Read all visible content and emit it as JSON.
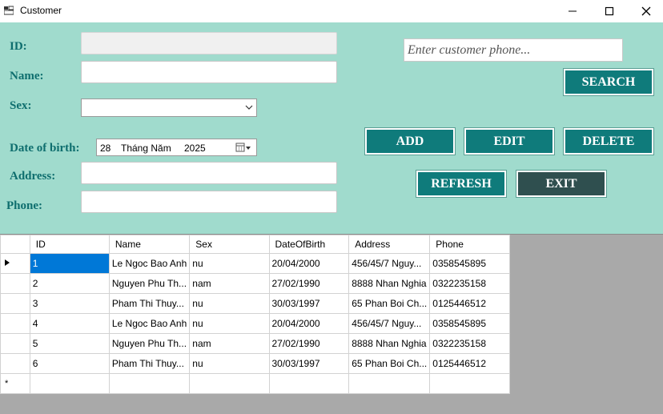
{
  "window": {
    "title": "Customer"
  },
  "form": {
    "labels": {
      "id": "ID:",
      "name": "Name:",
      "sex": "Sex:",
      "dob": "Date of birth:",
      "address": "Address:",
      "phone": "Phone:"
    },
    "values": {
      "id": "",
      "name": "",
      "sex": "",
      "address": "",
      "phone": ""
    },
    "dob": {
      "day": "28",
      "month": "Tháng Năm",
      "year": "2025"
    }
  },
  "search": {
    "placeholder": "Enter customer phone...",
    "button": "SEARCH"
  },
  "buttons": {
    "add": "ADD",
    "edit": "EDIT",
    "delete": "DELETE",
    "refresh": "REFRESH",
    "exit": "EXIT"
  },
  "colors": {
    "form_bg": "#a0dbcd",
    "label": "#0e6e6e",
    "button": "#0f7b7b",
    "exit_button": "#2f4f4f",
    "selection": "#0078d7"
  },
  "grid": {
    "columns": [
      "ID",
      "Name",
      "Sex",
      "DateOfBirth",
      "Address",
      "Phone"
    ],
    "rows": [
      [
        "1",
        "Le Ngoc Bao Anh",
        "nu",
        "20/04/2000",
        "456/45/7 Nguy...",
        "0358545895"
      ],
      [
        "2",
        "Nguyen Phu Th...",
        "nam",
        "27/02/1990",
        "8888 Nhan Nghia",
        "0322235158"
      ],
      [
        "3",
        "Pham Thi Thuy...",
        "nu",
        "30/03/1997",
        "65 Phan Boi Ch...",
        "0125446512"
      ],
      [
        "4",
        "Le Ngoc Bao Anh",
        "nu",
        "20/04/2000",
        "456/45/7 Nguy...",
        "0358545895"
      ],
      [
        "5",
        "Nguyen Phu Th...",
        "nam",
        "27/02/1990",
        "8888 Nhan Nghia",
        "0322235158"
      ],
      [
        "6",
        "Pham Thi Thuy...",
        "nu",
        "30/03/1997",
        "65 Phan Boi Ch...",
        "0125446512"
      ]
    ],
    "selected_row": 0,
    "new_row_marker": "*"
  }
}
